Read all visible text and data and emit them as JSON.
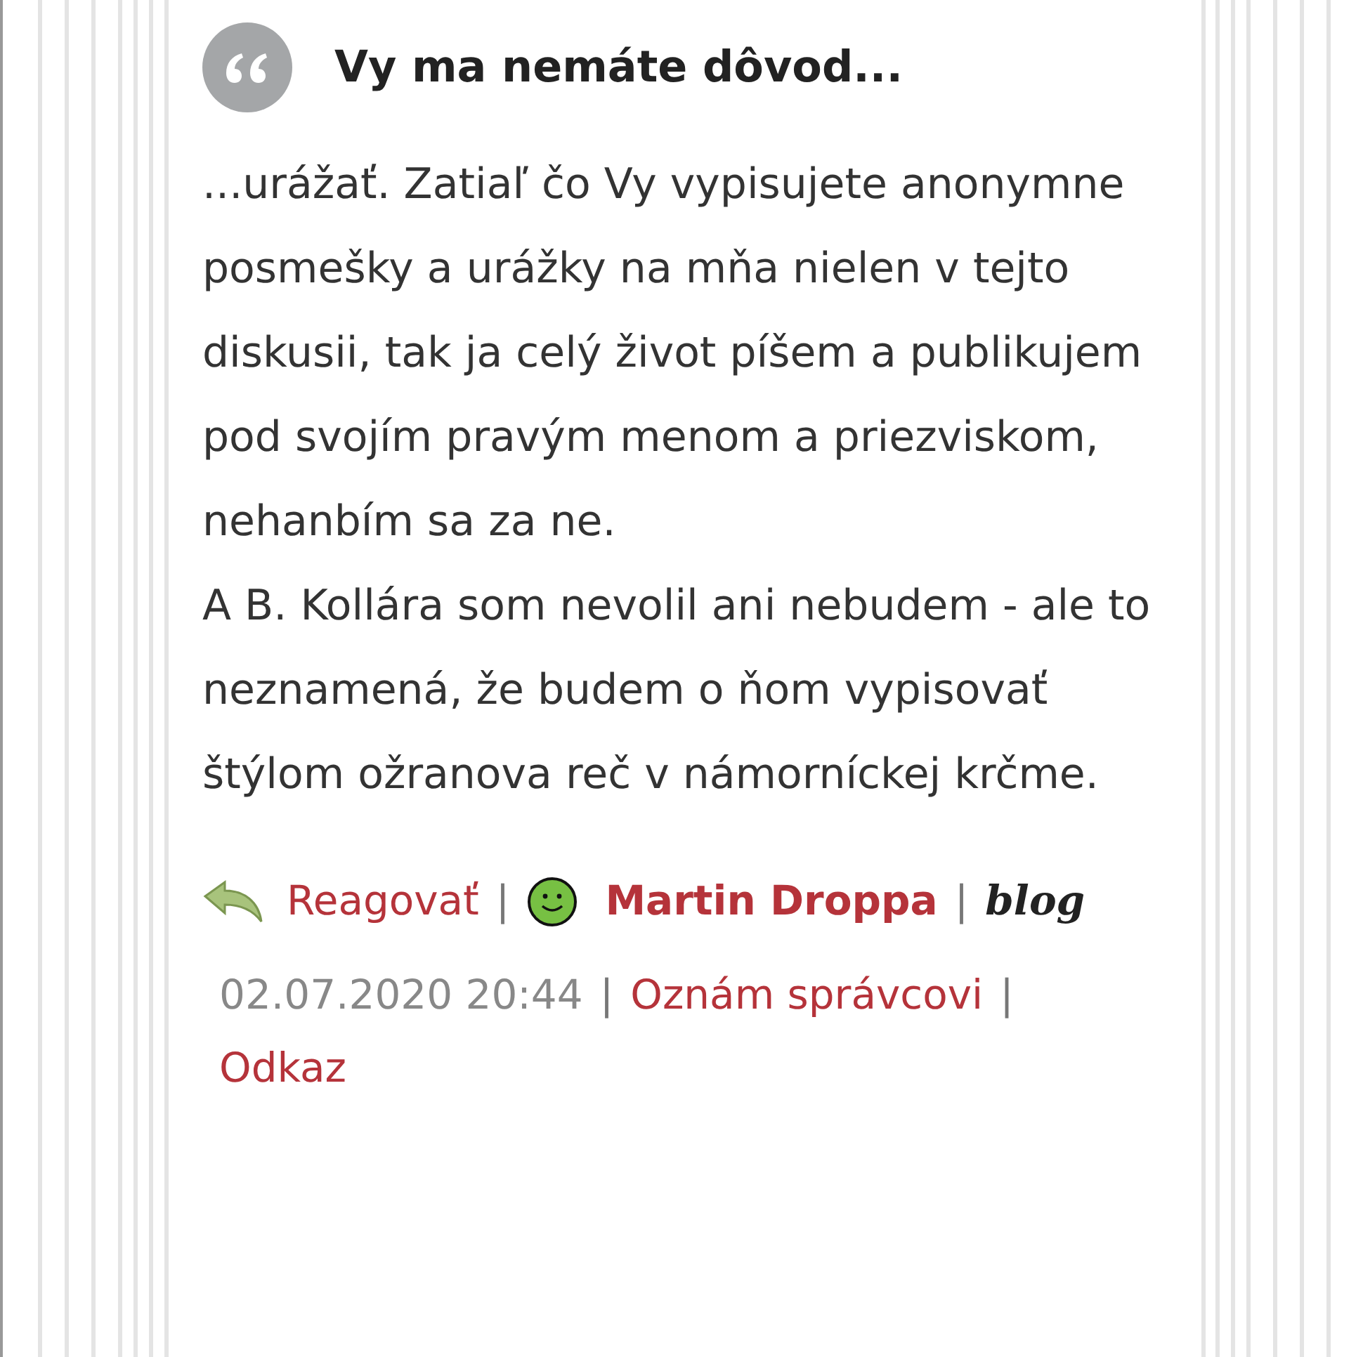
{
  "comment": {
    "title": "Vy ma nemáte dôvod...",
    "paragraphs": [
      "...urážať. Zatiaľ čo Vy vypisujete anonymne posmešky a urážky na mňa nielen v tejto diskusii, tak ja celý život píšem a publikujem pod svojím pravým menom a priezviskom, nehanbím sa za ne.",
      "A B. Kollára som nevolil ani nebudem - ale to neznamená, že budem o ňom vypisovať štýlom ožranova reč v námorníckej krčme."
    ],
    "reply_link": "Reagovať",
    "separators": [
      "|",
      "|",
      "|",
      "|"
    ],
    "author": "Martin Droppa",
    "blog_badge": "blog",
    "date": "02.07.2020 20:44",
    "report_link": "Oznám správcovi",
    "permalink": "Odkaz"
  }
}
